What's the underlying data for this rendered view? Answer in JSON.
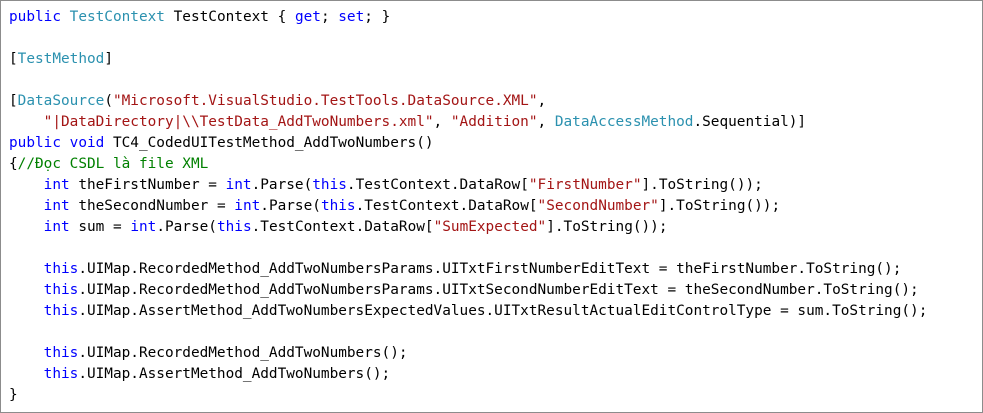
{
  "colors": {
    "keyword": "#0000ff",
    "type": "#2b91af",
    "string": "#a31515",
    "comment": "#008000",
    "plain": "#000000",
    "background": "#ffffff",
    "border": "#8c8c8c"
  },
  "lines": [
    [
      [
        "kw",
        "public"
      ],
      [
        "pl",
        " "
      ],
      [
        "typ",
        "TestContext"
      ],
      [
        "pl",
        " TestContext { "
      ],
      [
        "kw",
        "get"
      ],
      [
        "pl",
        "; "
      ],
      [
        "kw",
        "set"
      ],
      [
        "pl",
        "; }"
      ]
    ],
    [],
    [
      [
        "pl",
        "["
      ],
      [
        "typ",
        "TestMethod"
      ],
      [
        "pl",
        "]"
      ]
    ],
    [],
    [
      [
        "pl",
        "["
      ],
      [
        "typ",
        "DataSource"
      ],
      [
        "pl",
        "("
      ],
      [
        "str",
        "\"Microsoft.VisualStudio.TestTools.DataSource.XML\""
      ],
      [
        "pl",
        ","
      ]
    ],
    [
      [
        "pl",
        "    "
      ],
      [
        "str",
        "\"|DataDirectory|\\\\TestData_AddTwoNumbers.xml\""
      ],
      [
        "pl",
        ", "
      ],
      [
        "str",
        "\"Addition\""
      ],
      [
        "pl",
        ", "
      ],
      [
        "typ",
        "DataAccessMethod"
      ],
      [
        "pl",
        ".Sequential)]"
      ]
    ],
    [
      [
        "kw",
        "public"
      ],
      [
        "pl",
        " "
      ],
      [
        "kw",
        "void"
      ],
      [
        "pl",
        " TC4_CodedUITestMethod_AddTwoNumbers()"
      ]
    ],
    [
      [
        "pl",
        "{"
      ],
      [
        "com",
        "//Đọc CSDL là file XML"
      ]
    ],
    [
      [
        "pl",
        "    "
      ],
      [
        "kw",
        "int"
      ],
      [
        "pl",
        " theFirstNumber = "
      ],
      [
        "kw",
        "int"
      ],
      [
        "pl",
        ".Parse("
      ],
      [
        "kw",
        "this"
      ],
      [
        "pl",
        ".TestContext.DataRow["
      ],
      [
        "str",
        "\"FirstNumber\""
      ],
      [
        "pl",
        "].ToString());"
      ]
    ],
    [
      [
        "pl",
        "    "
      ],
      [
        "kw",
        "int"
      ],
      [
        "pl",
        " theSecondNumber = "
      ],
      [
        "kw",
        "int"
      ],
      [
        "pl",
        ".Parse("
      ],
      [
        "kw",
        "this"
      ],
      [
        "pl",
        ".TestContext.DataRow["
      ],
      [
        "str",
        "\"SecondNumber\""
      ],
      [
        "pl",
        "].ToString());"
      ]
    ],
    [
      [
        "pl",
        "    "
      ],
      [
        "kw",
        "int"
      ],
      [
        "pl",
        " sum = "
      ],
      [
        "kw",
        "int"
      ],
      [
        "pl",
        ".Parse("
      ],
      [
        "kw",
        "this"
      ],
      [
        "pl",
        ".TestContext.DataRow["
      ],
      [
        "str",
        "\"SumExpected\""
      ],
      [
        "pl",
        "].ToString());"
      ]
    ],
    [],
    [
      [
        "pl",
        "    "
      ],
      [
        "kw",
        "this"
      ],
      [
        "pl",
        ".UIMap.RecordedMethod_AddTwoNumbersParams.UITxtFirstNumberEditText = theFirstNumber.ToString();"
      ]
    ],
    [
      [
        "pl",
        "    "
      ],
      [
        "kw",
        "this"
      ],
      [
        "pl",
        ".UIMap.RecordedMethod_AddTwoNumbersParams.UITxtSecondNumberEditText = theSecondNumber.ToString();"
      ]
    ],
    [
      [
        "pl",
        "    "
      ],
      [
        "kw",
        "this"
      ],
      [
        "pl",
        ".UIMap.AssertMethod_AddTwoNumbersExpectedValues.UITxtResultActualEditControlType = sum.ToString();"
      ]
    ],
    [],
    [
      [
        "pl",
        "    "
      ],
      [
        "kw",
        "this"
      ],
      [
        "pl",
        ".UIMap.RecordedMethod_AddTwoNumbers();"
      ]
    ],
    [
      [
        "pl",
        "    "
      ],
      [
        "kw",
        "this"
      ],
      [
        "pl",
        ".UIMap.AssertMethod_AddTwoNumbers();"
      ]
    ],
    [
      [
        "pl",
        "}"
      ]
    ]
  ]
}
